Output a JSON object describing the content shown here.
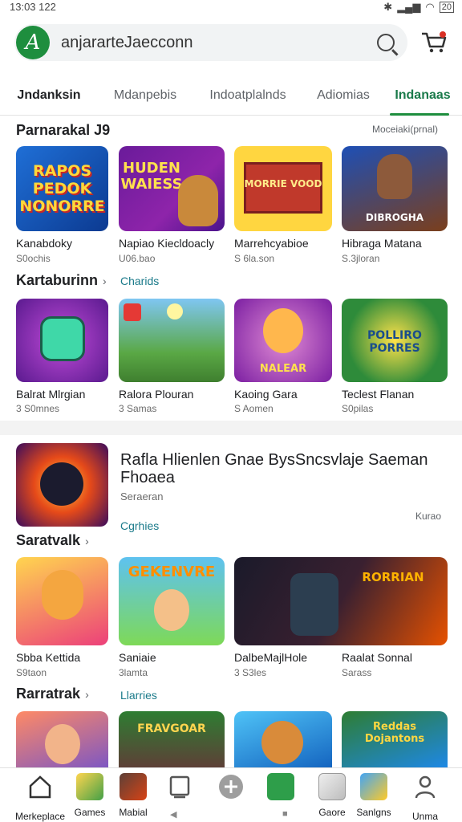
{
  "status_bar": {
    "time": "13:03 122",
    "battery": "20"
  },
  "search": {
    "logo_letter": "A",
    "value": "anjararteJaecconn"
  },
  "tabs": [
    "Jndanksin",
    "Mdanpebis",
    "Indoatplalnds",
    "Adiomias",
    "Indanaas"
  ],
  "section1": {
    "title": "Parnarakal J9",
    "right_note": "Moceiaki(prnal)",
    "items": [
      {
        "art": "RAPOS PEDOK NONORRE",
        "title": "Kanabdoky",
        "sub": "S0ochis"
      },
      {
        "art": "HUDEN WAIESS",
        "title": "Napiao Kiecldoacly",
        "sub": "U06.bao"
      },
      {
        "art": "MORRIE VOOD",
        "title": "Marrehcyabioe",
        "sub": "S 6la.son"
      },
      {
        "art": "DIBROGHA",
        "title": "Hibraga Matana",
        "sub": "S.3jloran"
      }
    ]
  },
  "section2": {
    "title": "Kartaburinn",
    "link": "Charids",
    "items": [
      {
        "art": "",
        "title": "Balrat Mlrgian",
        "sub": "3 S0mnes"
      },
      {
        "art": "",
        "title": "Ralora Plouran",
        "sub": "3 Samas"
      },
      {
        "art": "NALEAR",
        "title": "Kaoing Gara",
        "sub": "S Aomen"
      },
      {
        "art": "POLLIRO PORRES",
        "title": "Teclest Flanan",
        "sub": "S0pilas"
      }
    ]
  },
  "feature": {
    "title": "Rafla Hlienlen Gnae BysSncsvlaje Saeman Fhoaea",
    "sub": "Seraeran",
    "note": "Kurao"
  },
  "section3": {
    "title": "Saratvalk",
    "link": "Cgrhies",
    "items": [
      {
        "art": "",
        "title": "Sbba Kettida",
        "sub": "S9taon"
      },
      {
        "art": "GEKENVRE",
        "title": "Saniaie",
        "sub": "3lamta"
      },
      {
        "art": "RORRIAN",
        "title": "DalbeMajlHole",
        "sub": "3 S3les"
      },
      {
        "art": "",
        "title": "Raalat Sonnal",
        "sub": "Sarass"
      }
    ]
  },
  "section4": {
    "title": "Rarratrak",
    "link": "Llarries",
    "items": [
      {
        "art": ""
      },
      {
        "art": "FRAVGOAR"
      },
      {
        "art": ""
      },
      {
        "art": "Reddas Dojantons"
      }
    ]
  },
  "bottom_nav": [
    "Merkeplace",
    "Games",
    "Mabial",
    "",
    "",
    "",
    "Gaore",
    "Sanlgns",
    "Unma"
  ],
  "colors": {
    "accent": "#1e8e3e",
    "link": "#1a7a8a"
  }
}
